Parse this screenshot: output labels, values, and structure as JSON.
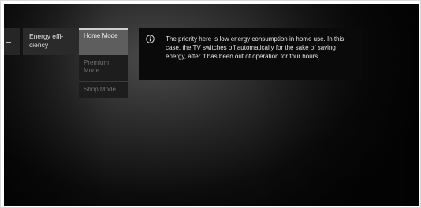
{
  "menu": {
    "category_label": "Energy effi-\nciency",
    "options": [
      {
        "label": "Home Mode",
        "selected": true
      },
      {
        "label": "Premium\nMode",
        "selected": false
      },
      {
        "label": "Shop Mode",
        "selected": false
      }
    ]
  },
  "info": {
    "icon": "info-circle-icon",
    "text": "The priority here is low energy consumption in home use. In this case, the TV switches off automatically for the sake of saving energy, after it has been out of operation for four hours."
  },
  "colors": {
    "selected_bg": "#5e5e5e",
    "panel_bg": "#0a0a0a",
    "text_primary": "#e6e6e6",
    "text_disabled": "#707070"
  }
}
